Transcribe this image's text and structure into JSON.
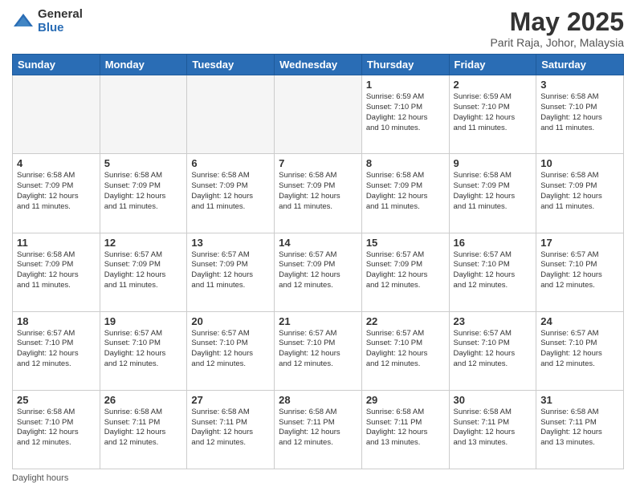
{
  "header": {
    "logo_general": "General",
    "logo_blue": "Blue",
    "main_title": "May 2025",
    "subtitle": "Parit Raja, Johor, Malaysia"
  },
  "footer": {
    "daylight_label": "Daylight hours"
  },
  "columns": [
    "Sunday",
    "Monday",
    "Tuesday",
    "Wednesday",
    "Thursday",
    "Friday",
    "Saturday"
  ],
  "weeks": [
    [
      {
        "day": "",
        "info": "",
        "empty": true
      },
      {
        "day": "",
        "info": "",
        "empty": true
      },
      {
        "day": "",
        "info": "",
        "empty": true
      },
      {
        "day": "",
        "info": "",
        "empty": true
      },
      {
        "day": "1",
        "info": "Sunrise: 6:59 AM\nSunset: 7:10 PM\nDaylight: 12 hours\nand 10 minutes.",
        "empty": false
      },
      {
        "day": "2",
        "info": "Sunrise: 6:59 AM\nSunset: 7:10 PM\nDaylight: 12 hours\nand 11 minutes.",
        "empty": false
      },
      {
        "day": "3",
        "info": "Sunrise: 6:58 AM\nSunset: 7:10 PM\nDaylight: 12 hours\nand 11 minutes.",
        "empty": false
      }
    ],
    [
      {
        "day": "4",
        "info": "Sunrise: 6:58 AM\nSunset: 7:09 PM\nDaylight: 12 hours\nand 11 minutes.",
        "empty": false
      },
      {
        "day": "5",
        "info": "Sunrise: 6:58 AM\nSunset: 7:09 PM\nDaylight: 12 hours\nand 11 minutes.",
        "empty": false
      },
      {
        "day": "6",
        "info": "Sunrise: 6:58 AM\nSunset: 7:09 PM\nDaylight: 12 hours\nand 11 minutes.",
        "empty": false
      },
      {
        "day": "7",
        "info": "Sunrise: 6:58 AM\nSunset: 7:09 PM\nDaylight: 12 hours\nand 11 minutes.",
        "empty": false
      },
      {
        "day": "8",
        "info": "Sunrise: 6:58 AM\nSunset: 7:09 PM\nDaylight: 12 hours\nand 11 minutes.",
        "empty": false
      },
      {
        "day": "9",
        "info": "Sunrise: 6:58 AM\nSunset: 7:09 PM\nDaylight: 12 hours\nand 11 minutes.",
        "empty": false
      },
      {
        "day": "10",
        "info": "Sunrise: 6:58 AM\nSunset: 7:09 PM\nDaylight: 12 hours\nand 11 minutes.",
        "empty": false
      }
    ],
    [
      {
        "day": "11",
        "info": "Sunrise: 6:58 AM\nSunset: 7:09 PM\nDaylight: 12 hours\nand 11 minutes.",
        "empty": false
      },
      {
        "day": "12",
        "info": "Sunrise: 6:57 AM\nSunset: 7:09 PM\nDaylight: 12 hours\nand 11 minutes.",
        "empty": false
      },
      {
        "day": "13",
        "info": "Sunrise: 6:57 AM\nSunset: 7:09 PM\nDaylight: 12 hours\nand 11 minutes.",
        "empty": false
      },
      {
        "day": "14",
        "info": "Sunrise: 6:57 AM\nSunset: 7:09 PM\nDaylight: 12 hours\nand 12 minutes.",
        "empty": false
      },
      {
        "day": "15",
        "info": "Sunrise: 6:57 AM\nSunset: 7:09 PM\nDaylight: 12 hours\nand 12 minutes.",
        "empty": false
      },
      {
        "day": "16",
        "info": "Sunrise: 6:57 AM\nSunset: 7:10 PM\nDaylight: 12 hours\nand 12 minutes.",
        "empty": false
      },
      {
        "day": "17",
        "info": "Sunrise: 6:57 AM\nSunset: 7:10 PM\nDaylight: 12 hours\nand 12 minutes.",
        "empty": false
      }
    ],
    [
      {
        "day": "18",
        "info": "Sunrise: 6:57 AM\nSunset: 7:10 PM\nDaylight: 12 hours\nand 12 minutes.",
        "empty": false
      },
      {
        "day": "19",
        "info": "Sunrise: 6:57 AM\nSunset: 7:10 PM\nDaylight: 12 hours\nand 12 minutes.",
        "empty": false
      },
      {
        "day": "20",
        "info": "Sunrise: 6:57 AM\nSunset: 7:10 PM\nDaylight: 12 hours\nand 12 minutes.",
        "empty": false
      },
      {
        "day": "21",
        "info": "Sunrise: 6:57 AM\nSunset: 7:10 PM\nDaylight: 12 hours\nand 12 minutes.",
        "empty": false
      },
      {
        "day": "22",
        "info": "Sunrise: 6:57 AM\nSunset: 7:10 PM\nDaylight: 12 hours\nand 12 minutes.",
        "empty": false
      },
      {
        "day": "23",
        "info": "Sunrise: 6:57 AM\nSunset: 7:10 PM\nDaylight: 12 hours\nand 12 minutes.",
        "empty": false
      },
      {
        "day": "24",
        "info": "Sunrise: 6:57 AM\nSunset: 7:10 PM\nDaylight: 12 hours\nand 12 minutes.",
        "empty": false
      }
    ],
    [
      {
        "day": "25",
        "info": "Sunrise: 6:58 AM\nSunset: 7:10 PM\nDaylight: 12 hours\nand 12 minutes.",
        "empty": false
      },
      {
        "day": "26",
        "info": "Sunrise: 6:58 AM\nSunset: 7:11 PM\nDaylight: 12 hours\nand 12 minutes.",
        "empty": false
      },
      {
        "day": "27",
        "info": "Sunrise: 6:58 AM\nSunset: 7:11 PM\nDaylight: 12 hours\nand 12 minutes.",
        "empty": false
      },
      {
        "day": "28",
        "info": "Sunrise: 6:58 AM\nSunset: 7:11 PM\nDaylight: 12 hours\nand 12 minutes.",
        "empty": false
      },
      {
        "day": "29",
        "info": "Sunrise: 6:58 AM\nSunset: 7:11 PM\nDaylight: 12 hours\nand 13 minutes.",
        "empty": false
      },
      {
        "day": "30",
        "info": "Sunrise: 6:58 AM\nSunset: 7:11 PM\nDaylight: 12 hours\nand 13 minutes.",
        "empty": false
      },
      {
        "day": "31",
        "info": "Sunrise: 6:58 AM\nSunset: 7:11 PM\nDaylight: 12 hours\nand 13 minutes.",
        "empty": false
      }
    ]
  ]
}
